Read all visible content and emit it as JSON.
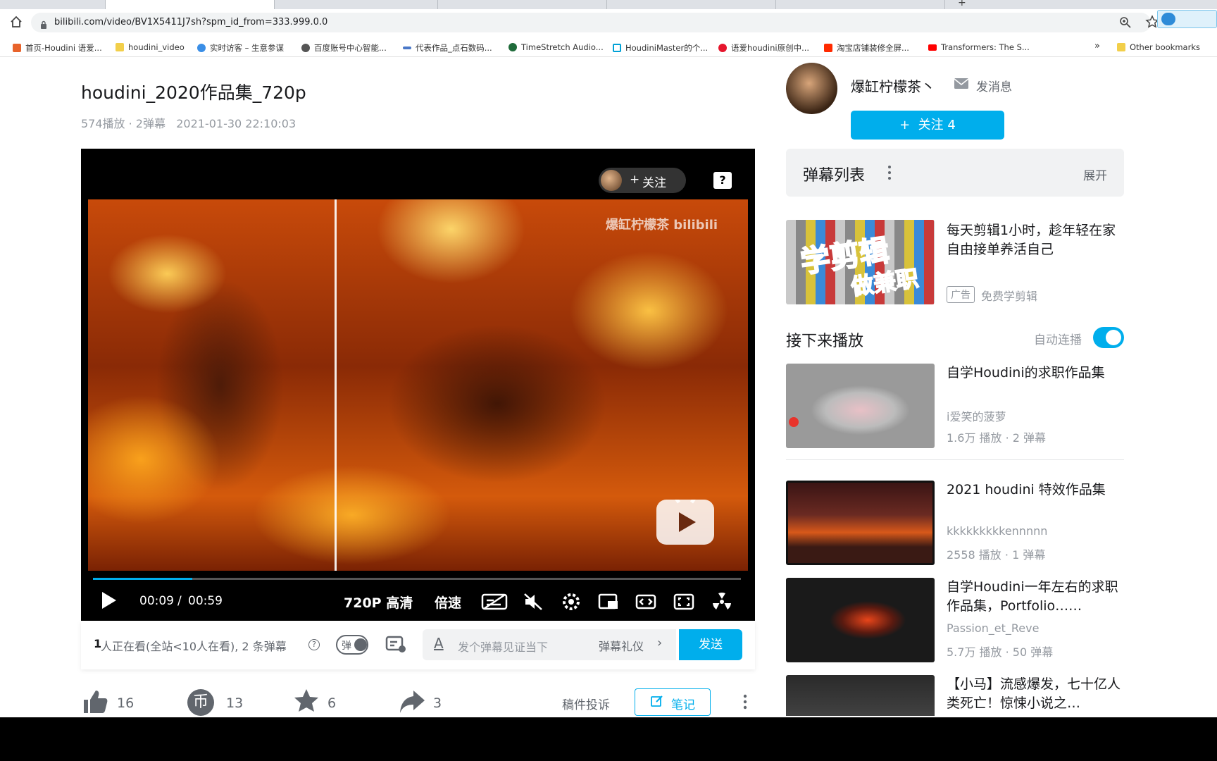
{
  "browser": {
    "url": "bilibili.com/video/BV1X5411J7sh?spm_id_from=333.999.0.0",
    "bookmarks": [
      "首页-Houdini 语爱...",
      "houdini_video",
      "实时访客 – 生意参谋",
      "百度账号中心智能...",
      "代表作品_点石数码...",
      "TimeStretch Audio...",
      "HoudiniMaster的个...",
      "语爱houdini原创中...",
      "淘宝店铺装修全屏...",
      "Transformers: The S...",
      "Other bookmarks"
    ],
    "more": "»"
  },
  "video": {
    "title": "houdini_2020作品集_720p",
    "meta": "574播放 · 2弹幕   2021-01-30 22:10:03",
    "follow_label": "关注",
    "watermark": "爆缸柠檬茶 bilibili",
    "time_current": "00:09",
    "time_sep": "/",
    "time_total": "00:59",
    "progress": 0.153,
    "quality": "720P 高清",
    "speed": "倍速"
  },
  "danmaku_bar": {
    "viewers_count": "1",
    "viewers_text": " 人正在看(全站<10人在看), 2 条弹幕",
    "toggle_label": "弹",
    "input_placeholder": "发个弹幕见证当下",
    "etiquette": "弹幕礼仪",
    "send": "发送"
  },
  "actions": {
    "like": "16",
    "coin": "13",
    "favorite": "6",
    "share": "3",
    "report": "稿件投诉",
    "note": "笔记"
  },
  "uploader": {
    "name": "爆缸柠檬茶丶",
    "message": "发消息",
    "follow": "+  关注 4"
  },
  "danmaku_list": {
    "title": "弹幕列表",
    "expand": "展开"
  },
  "ad": {
    "title": "每天剪辑1小时，趁年轻在家自由接单养活自己",
    "tag": "广告",
    "source": "免费学剪辑",
    "thumb_text_1": "学剪辑",
    "thumb_text_2": "做兼职"
  },
  "next_up": {
    "title": "接下来播放",
    "autoplay": "自动连播"
  },
  "recommendations": [
    {
      "title": "自学Houdini的求职作品集",
      "author": "i爱笑的菠萝",
      "stats": "1.6万 播放 · 2 弹幕"
    },
    {
      "title": "2021 houdini 特效作品集",
      "author": "kkkkkkkkkennnnn",
      "stats": "2558 播放 · 1 弹幕"
    },
    {
      "title": "自学Houdini一年左右的求职作品集，Portfolio……",
      "author": "Passion_et_Reve",
      "stats": "5.7万 播放 · 50 弹幕"
    },
    {
      "title": "【小马】流感爆发，七十亿人类死亡！惊悚小说之…",
      "author": "",
      "stats": ""
    }
  ],
  "colors": {
    "accent": "#00aeec",
    "text": "#18191c",
    "muted": "#9499a0"
  }
}
